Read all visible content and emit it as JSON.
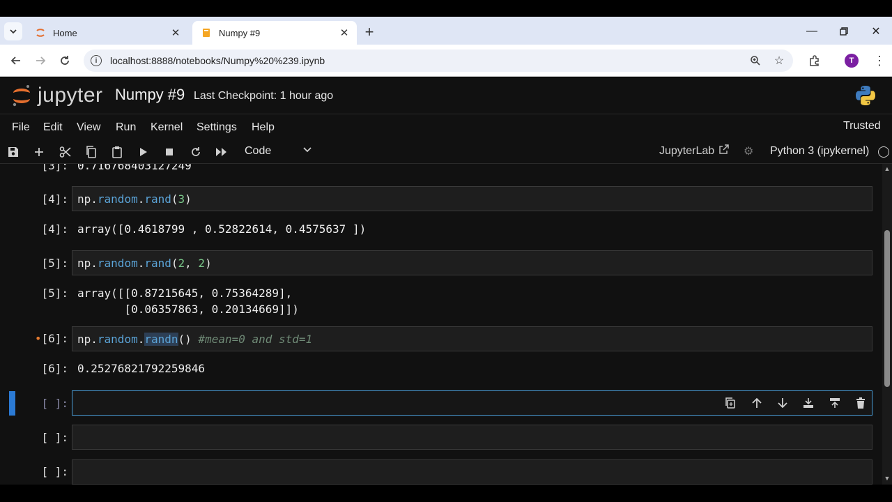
{
  "browser": {
    "tabs": [
      {
        "title": "Home",
        "active": false
      },
      {
        "title": "Numpy #9",
        "active": true
      }
    ],
    "url": "localhost:8888/notebooks/Numpy%20%239.ipynb",
    "profile_initial": "T"
  },
  "jupyter": {
    "logo_text": "jupyter",
    "notebook_title": "Numpy #9",
    "checkpoint": "Last Checkpoint: 1 hour ago",
    "menu": [
      "File",
      "Edit",
      "View",
      "Run",
      "Kernel",
      "Settings",
      "Help"
    ],
    "trusted": "Trusted",
    "cell_type": "Code",
    "jupyterlab_link": "JupyterLab",
    "kernel": "Python 3 (ipykernel)"
  },
  "cells": {
    "partial_output_prompt": "[3]:",
    "partial_output_text": "0.716768403127249",
    "c4_prompt": "[4]:",
    "c4_out_prompt": "[4]:",
    "c4_output": "array([0.4618799 , 0.52822614, 0.4575637 ])",
    "c5_prompt": "[5]:",
    "c5_out_prompt": "[5]:",
    "c5_output_line1": "array([[0.87215645, 0.75364289],",
    "c5_output_line2": "       [0.06357863, 0.20134669]])",
    "c6_prompt": "[6]:",
    "c6_out_prompt": "[6]:",
    "c6_comment": "#mean=0 and std=1",
    "c6_output": "0.25276821792259846",
    "empty_prompt": "[ ]:"
  },
  "colors": {
    "accent": "#2b7ad4",
    "code_attr": "#5ba4d8",
    "code_number": "#7ac88a",
    "modified_dot": "#e47a30"
  }
}
